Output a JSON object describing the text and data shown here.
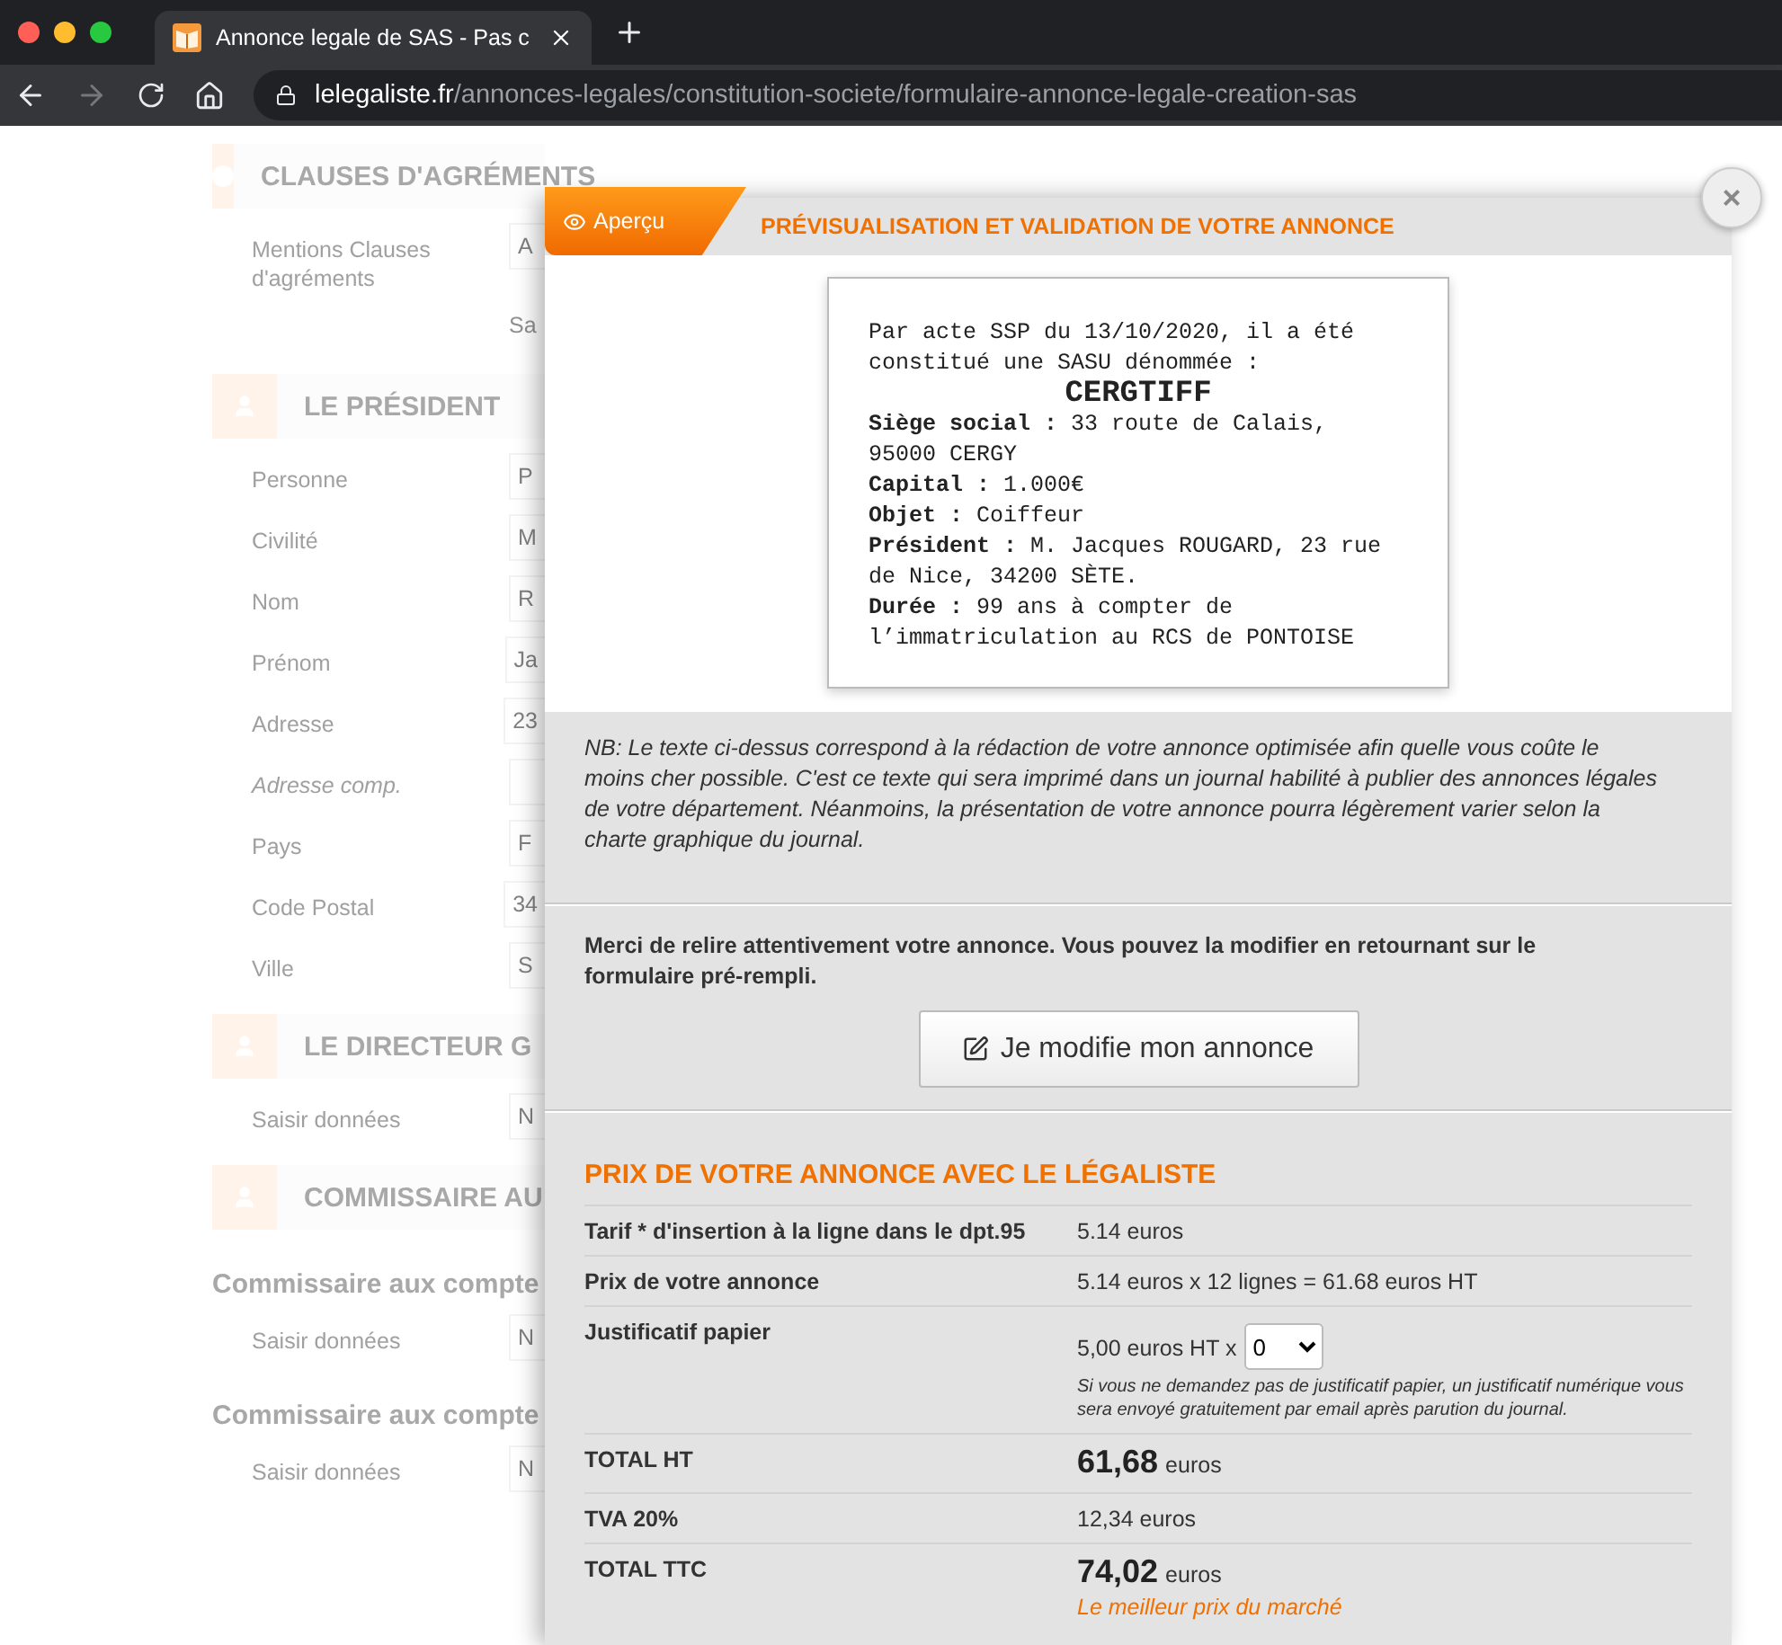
{
  "browser": {
    "tab_title": "Annonce legale de SAS - Pas c",
    "url_domain": "lelegaliste.fr",
    "url_path": "/annonces-legales/constitution-societe/formulaire-annonce-legale-creation-sas"
  },
  "background_form": [
    {
      "kind": "heading",
      "text": "CLAUSES D'AGRÉMENTS"
    },
    {
      "kind": "field",
      "label": "Mentions Clauses d'agréments",
      "value": "A"
    },
    {
      "kind": "note",
      "text": "Sa"
    },
    {
      "kind": "heading",
      "text": "LE PRÉSIDENT"
    },
    {
      "kind": "field",
      "label": "Personne",
      "value": "P"
    },
    {
      "kind": "field",
      "label": "Civilité",
      "value": "M"
    },
    {
      "kind": "field",
      "label": "Nom",
      "value": "R"
    },
    {
      "kind": "field",
      "label": "Prénom",
      "value": "Ja"
    },
    {
      "kind": "field",
      "label": "Adresse",
      "value": "23"
    },
    {
      "kind": "field",
      "label": "Adresse comp.",
      "optional": true
    },
    {
      "kind": "field",
      "label": "Pays",
      "value": "F"
    },
    {
      "kind": "field",
      "label": "Code Postal",
      "value": "34"
    },
    {
      "kind": "field",
      "label": "Ville",
      "value": "S"
    },
    {
      "kind": "heading",
      "text": "LE DIRECTEUR G"
    },
    {
      "kind": "field",
      "label": "Saisir données",
      "value": "N"
    },
    {
      "kind": "heading",
      "text": "COMMISSAIRE AU"
    },
    {
      "kind": "subheading",
      "text": "Commissaire aux compte"
    },
    {
      "kind": "field",
      "label": "Saisir données",
      "value": "N"
    },
    {
      "kind": "subheading",
      "text": "Commissaire aux compte"
    },
    {
      "kind": "field",
      "label": "Saisir données",
      "value": "N"
    }
  ],
  "modal": {
    "tab": "Aperçu",
    "title": "PRÉVISUALISATION ET VALIDATION DE VOTRE ANNONCE",
    "close": "×",
    "announcement": [
      {
        "kind": "text",
        "text": "Par acte SSP du 13/10/2020, il a été constitué une SASU dénommée :"
      },
      {
        "kind": "name",
        "text": "CERGTIFF"
      },
      {
        "kind": "text",
        "text": "**Siège social :** 33 route de Calais, 95000 CERGY"
      },
      {
        "kind": "text",
        "text": "**Capital :** 1.000€"
      },
      {
        "kind": "text",
        "text": "**Objet :** Coiffeur"
      },
      {
        "kind": "text",
        "text": "**Président :** M. Jacques ROUGARD, 23 rue de Nice, 34200 SÈTE."
      },
      {
        "kind": "text",
        "text": "**Durée :** 99 ans à compter de l’immatriculation au RCS de PONTOISE"
      }
    ],
    "nb": "NB: Le texte ci-dessus correspond à la rédaction de votre annonce optimisée afin quelle vous coûte le moins cher possible. C'est ce texte qui sera imprimé dans un journal habilité à publier des annonces légales de votre département. Néanmoins, la présentation de votre annonce pourra légèrement varier selon la charte graphique du journal.",
    "review": "Merci de relire attentivement votre annonce. Vous pouvez la modifier en retournant sur le formulaire pré-rempli.",
    "edit_button": "Je modifie mon annonce",
    "price_title": "PRIX DE VOTRE ANNONCE AVEC LE LÉGALISTE",
    "price_rows": [
      {
        "kind": "plain",
        "label": "Tarif * d'insertion à la ligne dans le dpt.95",
        "value": "5.14 euros"
      },
      {
        "kind": "plain",
        "label": "Prix de votre annonce",
        "value": "5.14 euros x 12 lignes = 61.68 euros HT"
      },
      {
        "kind": "select",
        "label": "Justificatif papier",
        "value": "5,00 euros HT x",
        "select": "0",
        "note": "Si vous ne demandez pas de justificatif papier, un justificatif numérique vous sera envoyé gratuitement par email après parution du journal."
      },
      {
        "kind": "total",
        "label": "TOTAL HT",
        "amount": "61,68",
        "unit": "euros"
      },
      {
        "kind": "plain",
        "label": "TVA 20%",
        "value": "12,34 euros"
      },
      {
        "kind": "total",
        "label": "TOTAL TTC",
        "amount": "74,02",
        "unit": "euros",
        "tagline": "Le meilleur prix du marché"
      }
    ]
  }
}
